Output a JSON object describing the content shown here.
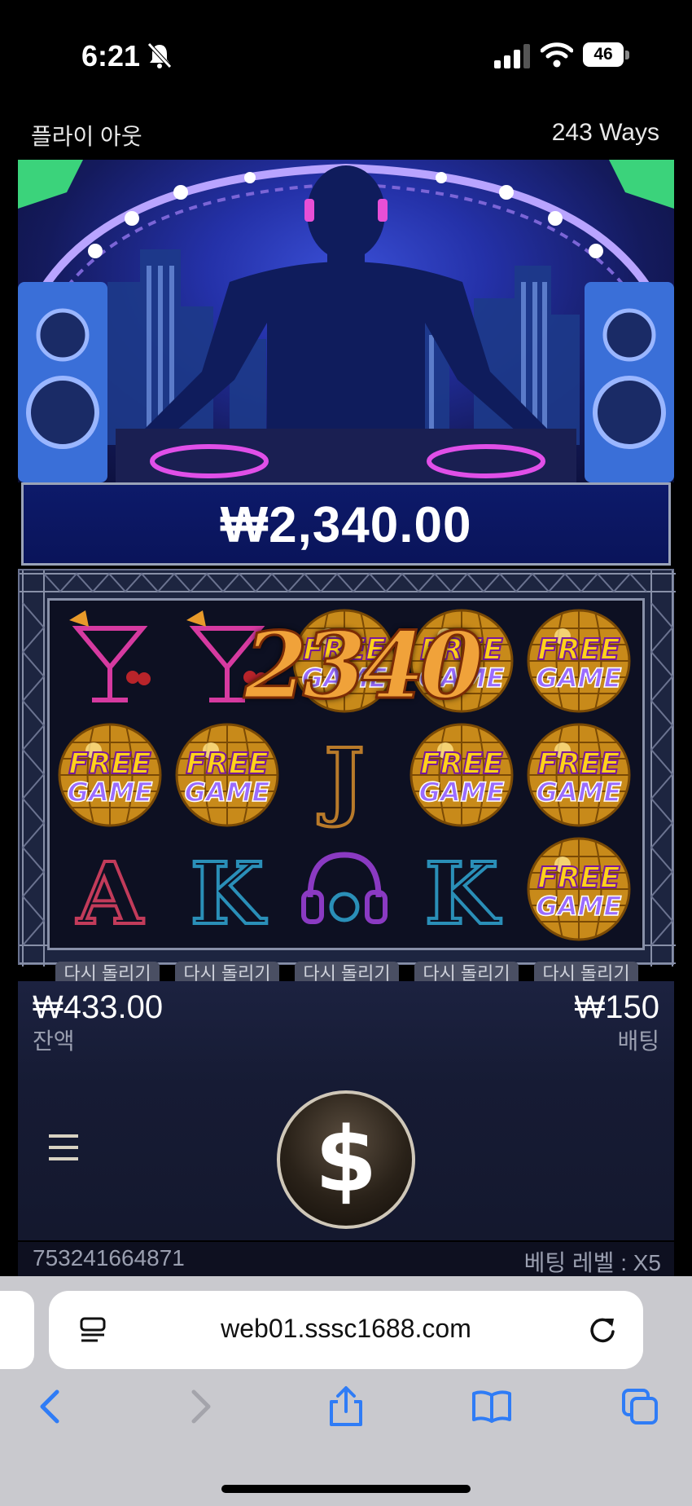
{
  "status_bar": {
    "time": "6:21",
    "battery": "46"
  },
  "game_header": {
    "fly_out": "플라이 아웃",
    "ways": "243 Ways"
  },
  "win_meter": "₩2,340.00",
  "win_overlay": "2340",
  "reels": [
    [
      "cocktail",
      "free-game",
      "letter-A"
    ],
    [
      "cocktail",
      "free-game",
      "letter-K"
    ],
    [
      "free-game",
      "letter-J",
      "headphones"
    ],
    [
      "free-game",
      "free-game",
      "letter-K"
    ],
    [
      "free-game",
      "free-game",
      "free-game"
    ]
  ],
  "free_game_label": {
    "line1": "FREE",
    "line2": "GAME"
  },
  "respin_label": "다시 돌리기",
  "balance": {
    "value": "₩433.00",
    "label": "잔액"
  },
  "bet": {
    "value": "₩150",
    "label": "배팅"
  },
  "spin_symbol": "$",
  "footer": {
    "round_id": "753241664871",
    "bet_level": "베팅 레벨 : X5"
  },
  "browser": {
    "url": "web01.sssc1688.com"
  },
  "colors": {
    "win_meter_bg": "#0d1a6a",
    "overlay_gold": "#f0a23a",
    "safari_bg": "#c9c9ce",
    "link_blue": "#2f7cf6"
  }
}
